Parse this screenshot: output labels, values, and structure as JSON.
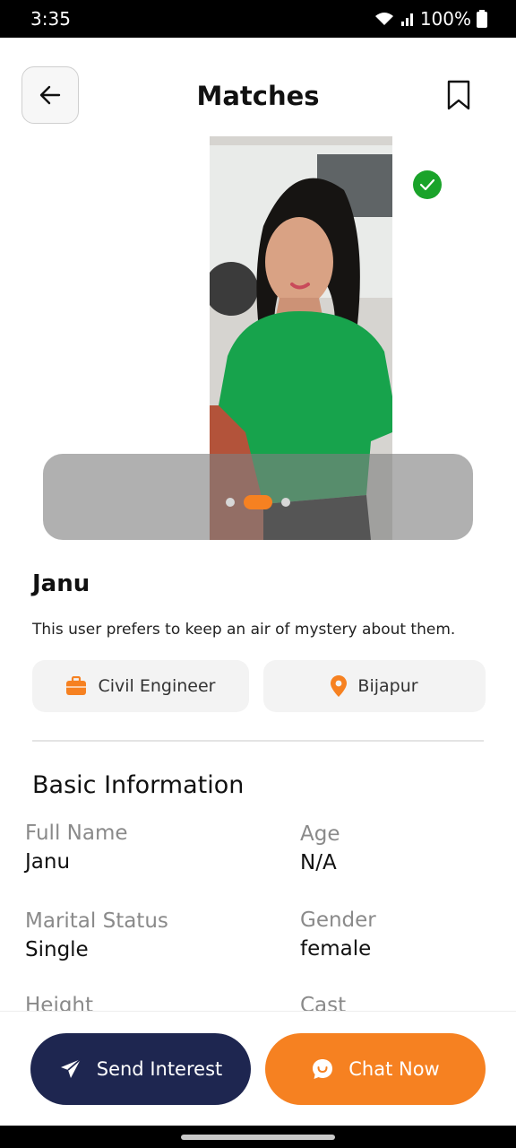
{
  "status_bar": {
    "time": "3:35",
    "battery": "100%"
  },
  "header": {
    "title": "Matches"
  },
  "photo": {
    "total_images": 3,
    "active_index": 1
  },
  "profile": {
    "name": "Janu",
    "bio": "This user prefers to keep an air of mystery about them.",
    "job": "Civil Engineer",
    "location": "Bijapur"
  },
  "basic_info": {
    "title": "Basic Information",
    "full_name_label": "Full Name",
    "full_name": "Janu",
    "age_label": "Age",
    "age": "N/A",
    "marital_label": "Marital Status",
    "marital": "Single",
    "gender_label": "Gender",
    "gender": "female",
    "height_label": "Height",
    "cast_label": "Cast"
  },
  "actions": {
    "send_interest": "Send Interest",
    "chat_now": "Chat Now"
  },
  "colors": {
    "accent": "#f68121",
    "navy": "#1e2650",
    "verified": "#1aa32a"
  },
  "icons": [
    "back-arrow-icon",
    "bookmark-icon",
    "verified-icon",
    "briefcase-icon",
    "location-pin-icon",
    "paper-plane-icon",
    "chat-bubble-icon"
  ]
}
